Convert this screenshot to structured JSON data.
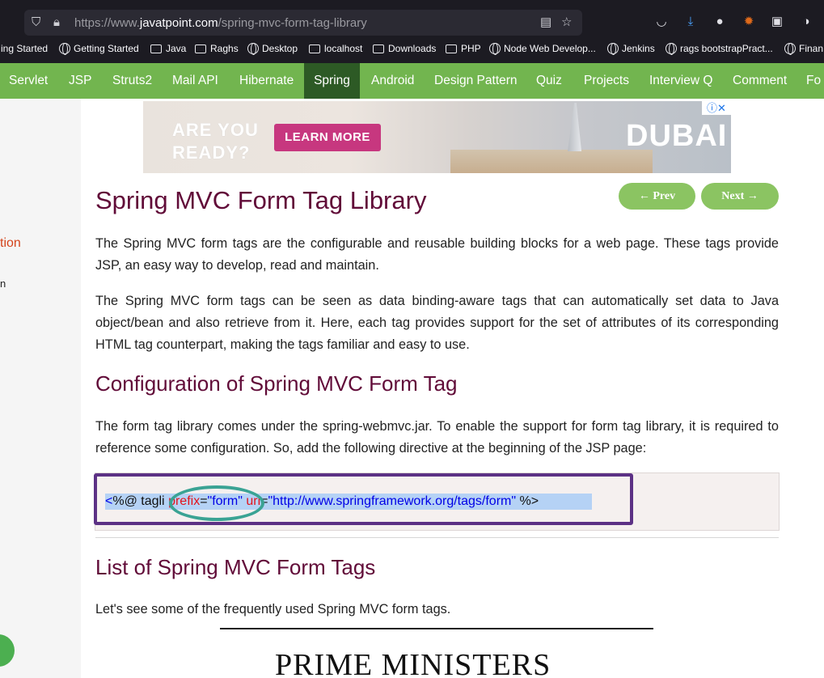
{
  "browser": {
    "url_prefix": "https://www.",
    "url_domain": "javatpoint.com",
    "url_path": "/spring-mvc-form-tag-library",
    "bookmarks": [
      {
        "label": "ing Started",
        "type": "none"
      },
      {
        "label": "Getting Started",
        "type": "globe"
      },
      {
        "label": "Java",
        "type": "folder"
      },
      {
        "label": "Raghs",
        "type": "folder"
      },
      {
        "label": "Desktop",
        "type": "globe"
      },
      {
        "label": "localhost",
        "type": "folder"
      },
      {
        "label": "Downloads",
        "type": "folder"
      },
      {
        "label": "PHP",
        "type": "folder"
      },
      {
        "label": "Node Web Develop...",
        "type": "globe"
      },
      {
        "label": "Jenkins",
        "type": "globe"
      },
      {
        "label": "rags bootstrapPract...",
        "type": "globe"
      },
      {
        "label": "Finan",
        "type": "globe"
      }
    ]
  },
  "nav": {
    "items": [
      "Servlet",
      "JSP",
      "Struts2",
      "Mail API",
      "Hibernate",
      "Spring",
      "Android",
      "Design Pattern",
      "Quiz",
      "Projects",
      "Interview Q",
      "Comment",
      "Fo"
    ],
    "active": "Spring"
  },
  "sidebar": {
    "partial_link": "tion",
    "partial_text": "n"
  },
  "ad": {
    "line1": "ARE YOU",
    "line2": "READY?",
    "button": "LEARN MORE",
    "brand": "DUBAI",
    "close_icons": "ⓘ✕"
  },
  "pager": {
    "prev": "← Prev",
    "next": "Next →"
  },
  "article": {
    "title": "Spring MVC Form Tag Library",
    "para1": "The Spring MVC form tags are the configurable and reusable building blocks for a web page. These tags provide JSP, an easy way to develop, read and maintain.",
    "para2": "The Spring MVC form tags can be seen as data binding-aware tags that can automatically set data to Java object/bean and also retrieve from it. Here, each tag provides support for the set of attributes of its corresponding HTML tag counterpart, making the tags familiar and easy to use.",
    "h2_config": "Configuration of Spring MVC Form Tag",
    "para3": "The form tag library comes under the spring-webmvc.jar. To enable the support for form tag library, it is required to reference some configuration. So, add the following directive at the beginning of the JSP page:",
    "code": {
      "open": "<",
      "directive": "%@ tagli",
      "sp1": " ",
      "attr1": "prefix",
      "eq1": "=",
      "val1": "\"form\"",
      "sp2": " ",
      "attr2": "uri",
      "eq2": "=",
      "val2": "\"http://www.springframework.org/tags/form\"",
      "close": " %>"
    },
    "h2_list": "List of Spring MVC Form Tags",
    "para4": "Let's see some of the frequently used Spring MVC form tags.",
    "image_caption": "PRIME MINISTERS"
  }
}
